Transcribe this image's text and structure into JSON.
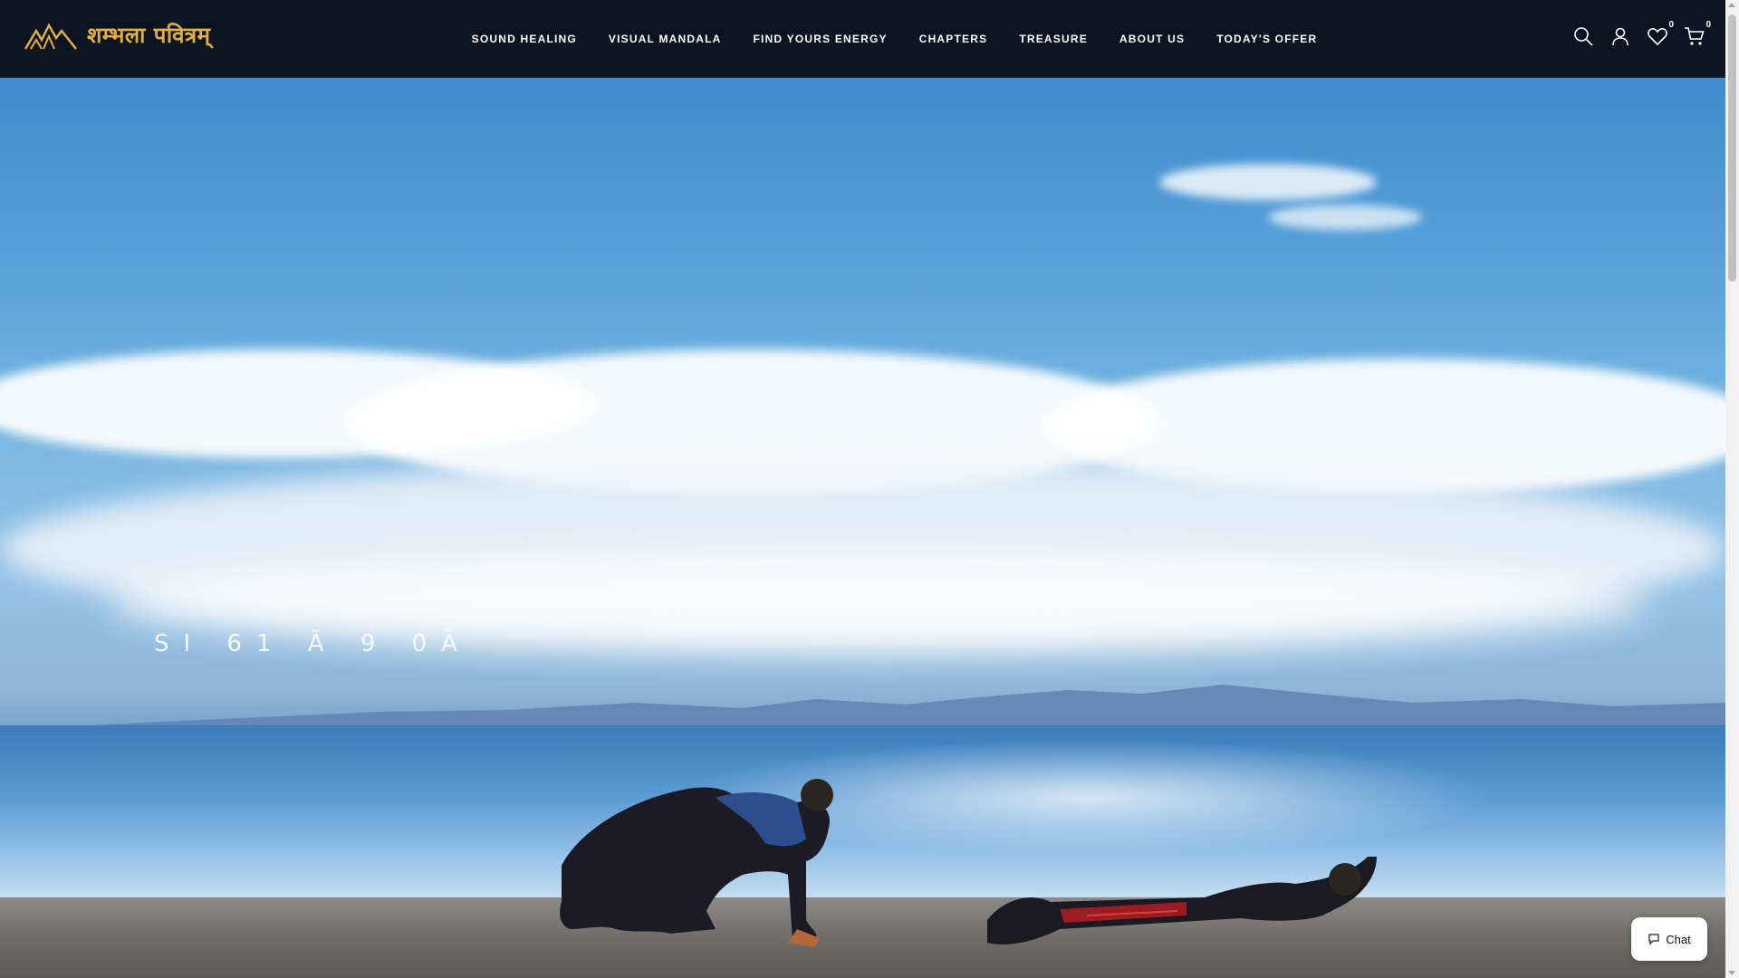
{
  "brand": {
    "logo_text": "शम्भला पवित्रम्",
    "accent": "#e2b13c"
  },
  "nav": {
    "items": [
      {
        "label": "SOUND HEALING"
      },
      {
        "label": "VISUAL MANDALA"
      },
      {
        "label": "FIND YOURS ENERGY"
      },
      {
        "label": "CHAPTERS"
      },
      {
        "label": "TREASURE"
      },
      {
        "label": "ABOUT US"
      },
      {
        "label": "TODAY'S OFFER"
      }
    ]
  },
  "header_icons": {
    "search": "search-icon",
    "account": "user-icon",
    "wishlist": {
      "icon": "heart-icon",
      "count": "0"
    },
    "cart": {
      "icon": "cart-icon",
      "count": "0"
    }
  },
  "hero": {
    "overlay_text": "SI 61 Ã 9 0Ã"
  },
  "chat": {
    "label": "Chat",
    "icon": "chat-bubble-icon"
  }
}
